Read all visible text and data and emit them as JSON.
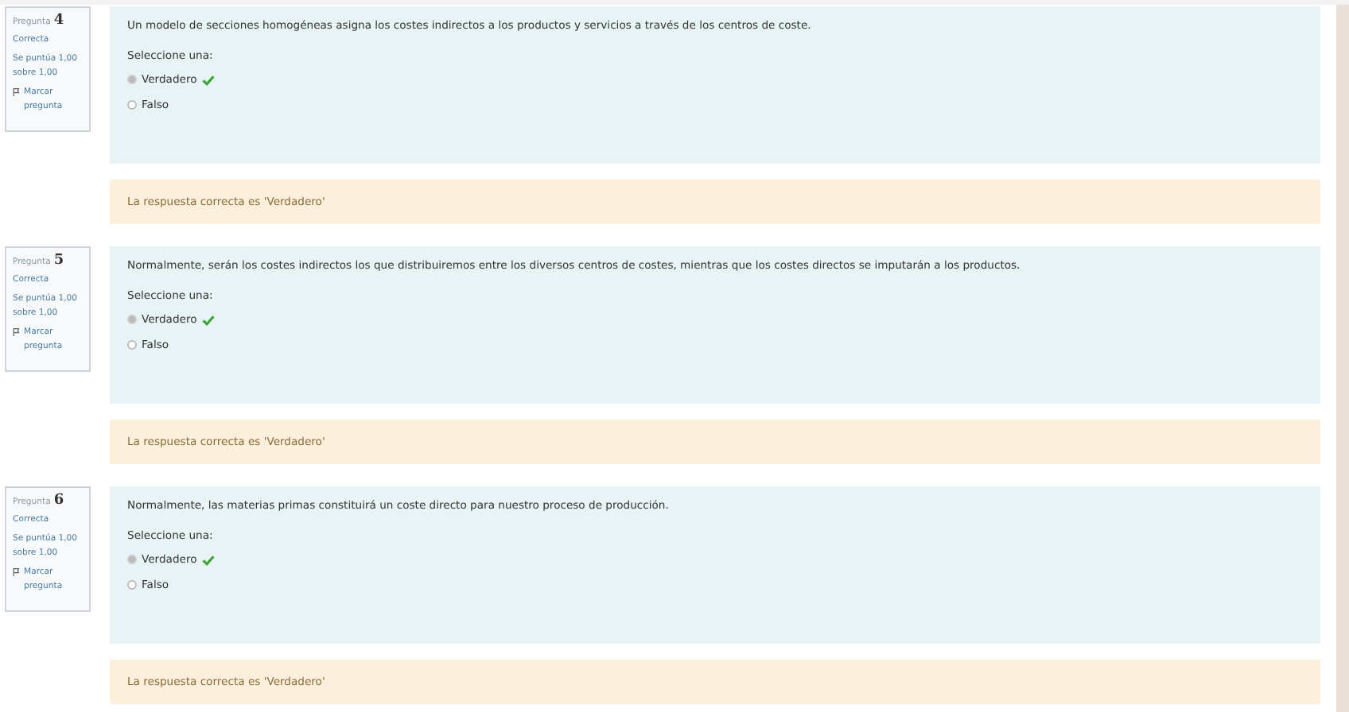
{
  "questions": [
    {
      "label": "Pregunta",
      "number": "4",
      "state": "Correcta",
      "grade": "Se puntúa 1,00 sobre 1,00",
      "flag": "Marcar pregunta",
      "text": "Un modelo de secciones homogéneas asigna los costes indirectos a los productos y servicios a través de los centros de coste.",
      "prompt": "Seleccione una:",
      "options": [
        {
          "label": "Verdadero",
          "selected": true,
          "correct": true
        },
        {
          "label": "Falso",
          "selected": false,
          "correct": false
        }
      ],
      "feedback": "La respuesta correcta es 'Verdadero'"
    },
    {
      "label": "Pregunta",
      "number": "5",
      "state": "Correcta",
      "grade": "Se puntúa 1,00 sobre 1,00",
      "flag": "Marcar pregunta",
      "text": "Normalmente, serán los costes indirectos los que distribuiremos entre los diversos centros de costes, mientras que los costes directos se imputarán a los productos.",
      "prompt": "Seleccione una:",
      "options": [
        {
          "label": "Verdadero",
          "selected": true,
          "correct": true
        },
        {
          "label": "Falso",
          "selected": false,
          "correct": false
        }
      ],
      "feedback": "La respuesta correcta es 'Verdadero'"
    },
    {
      "label": "Pregunta",
      "number": "6",
      "state": "Correcta",
      "grade": "Se puntúa 1,00 sobre 1,00",
      "flag": "Marcar pregunta",
      "text": "Normalmente, las materias primas constituirá un coste directo para nuestro proceso de producción.",
      "prompt": "Seleccione una:",
      "options": [
        {
          "label": "Verdadero",
          "selected": true,
          "correct": true
        },
        {
          "label": "Falso",
          "selected": false,
          "correct": false
        }
      ],
      "feedback": "La respuesta correcta es 'Verdadero'"
    }
  ]
}
